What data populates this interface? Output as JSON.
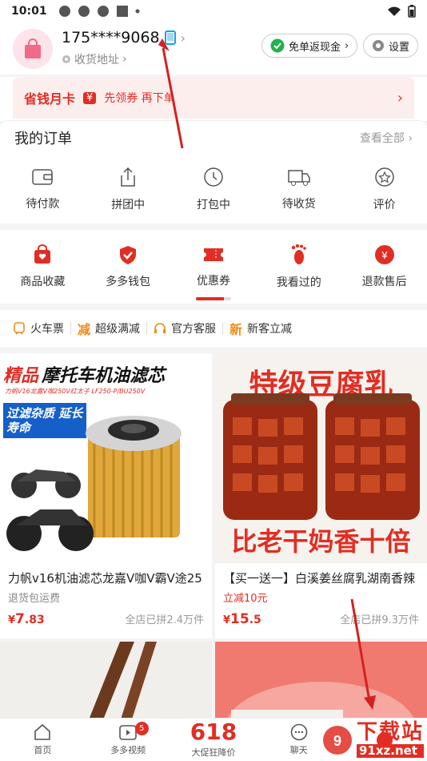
{
  "status_bar": {
    "time": "10:01"
  },
  "profile": {
    "phone": "175****9068",
    "address": "收货地址",
    "free_cashback": "免单返现金",
    "settings": "设置"
  },
  "month_card": {
    "title": "省钱月卡",
    "promo": "先领券 再下单"
  },
  "orders": {
    "title": "我的订单",
    "view_all": "查看全部",
    "items": [
      "待付款",
      "拼团中",
      "打包中",
      "待收货",
      "评价"
    ]
  },
  "shortcuts": {
    "items": [
      "商品收藏",
      "多多钱包",
      "优惠券",
      "我看过的",
      "退款售后"
    ]
  },
  "services": {
    "items": [
      "火车票",
      "超级满减",
      "官方客服",
      "新客立减"
    ]
  },
  "products": [
    {
      "banner": "精品",
      "banner2": "摩托车机油滤芯",
      "small": "力帆V16龙嘉V咖250V红太子 LF250-P/BU250V",
      "badge": "过滤杂质 延长寿命",
      "name": "力帆v16机油滤芯龙嘉V咖V霸V途25",
      "sub": "退货包运费",
      "price_int": "7",
      "price_dec": ".83",
      "sold": "全店已拼2.4万件"
    },
    {
      "banner": "特级豆腐乳",
      "bottom": "比老干妈香十倍",
      "name": "【买一送一】白溪姜丝腐乳湖南香辣",
      "sub": "立减10元",
      "price_int": "15",
      "price_dec": ".5",
      "sold": "全店已拼9.3万件"
    }
  ],
  "nav": {
    "home": "首页",
    "video": "多多视频",
    "video_badge": "5",
    "sale_big": "618",
    "sale": "大促狂降价",
    "chat": "聊天"
  },
  "watermark": {
    "text": "下载站",
    "url": "91xz.net"
  },
  "colors": {
    "brand": "#e02e24",
    "green": "#22b14c"
  }
}
